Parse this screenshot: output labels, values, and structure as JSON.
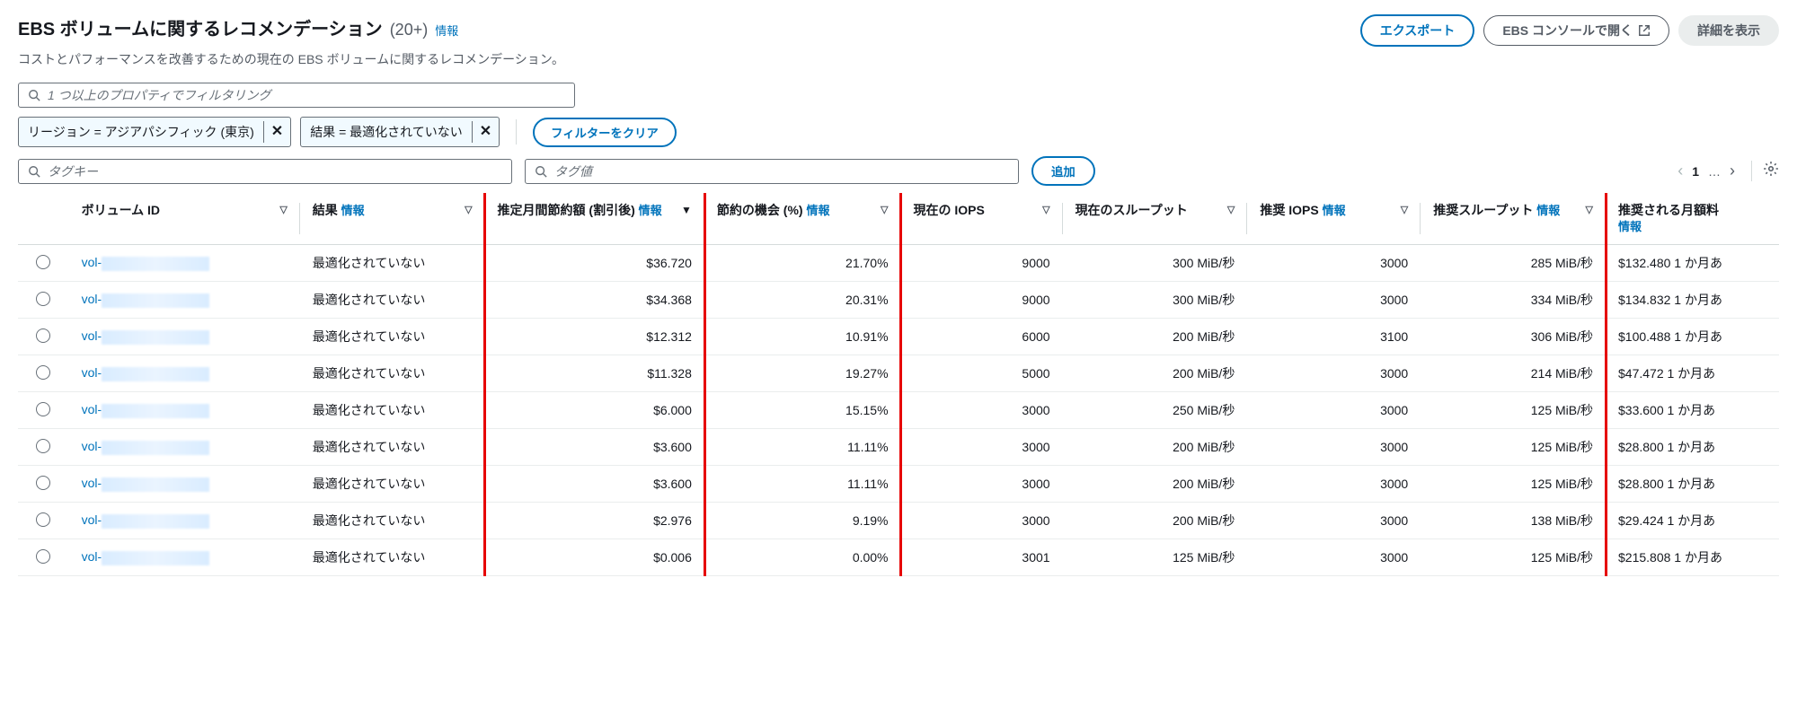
{
  "header": {
    "title": "EBS ボリュームに関するレコメンデーション",
    "count": "(20+)",
    "info": "情報",
    "subtitle": "コストとパフォーマンスを改善するための現在の EBS ボリュームに関するレコメンデーション。",
    "export_btn": "エクスポート",
    "console_btn": "EBS コンソールで開く",
    "detail_btn": "詳細を表示"
  },
  "filters": {
    "main_placeholder": "1 つ以上のプロパティでフィルタリング",
    "token_region": "リージョン = アジアパシフィック (東京)",
    "token_result": "結果 = 最適化されていない",
    "clear": "フィルターをクリア",
    "tagkey_placeholder": "タグキー",
    "tagval_placeholder": "タグ値",
    "add": "追加"
  },
  "pager": {
    "page": "1",
    "ellipsis": "…"
  },
  "columns": {
    "volume_id": "ボリューム ID",
    "result": "結果",
    "savings": "推定月間節約額 (割引後)",
    "opportunity": "節約の機会 (%)",
    "cur_iops": "現在の IOPS",
    "cur_tp": "現在のスループット",
    "rec_iops": "推奨 IOPS",
    "rec_tp": "推奨スループット",
    "rec_monthly": "推奨される月額料",
    "info": "情報"
  },
  "rows": [
    {
      "vol": "vol-",
      "res": "最適化されていない",
      "sav": "$36.720",
      "opp": "21.70%",
      "ci": "9000",
      "ct": "300 MiB/秒",
      "ri": "3000",
      "rt": "285 MiB/秒",
      "rm": "$132.480 1 か月あ"
    },
    {
      "vol": "vol-",
      "res": "最適化されていない",
      "sav": "$34.368",
      "opp": "20.31%",
      "ci": "9000",
      "ct": "300 MiB/秒",
      "ri": "3000",
      "rt": "334 MiB/秒",
      "rm": "$134.832 1 か月あ"
    },
    {
      "vol": "vol-",
      "res": "最適化されていない",
      "sav": "$12.312",
      "opp": "10.91%",
      "ci": "6000",
      "ct": "200 MiB/秒",
      "ri": "3100",
      "rt": "306 MiB/秒",
      "rm": "$100.488 1 か月あ"
    },
    {
      "vol": "vol-",
      "res": "最適化されていない",
      "sav": "$11.328",
      "opp": "19.27%",
      "ci": "5000",
      "ct": "200 MiB/秒",
      "ri": "3000",
      "rt": "214 MiB/秒",
      "rm": "$47.472 1 か月あ"
    },
    {
      "vol": "vol-",
      "res": "最適化されていない",
      "sav": "$6.000",
      "opp": "15.15%",
      "ci": "3000",
      "ct": "250 MiB/秒",
      "ri": "3000",
      "rt": "125 MiB/秒",
      "rm": "$33.600 1 か月あ"
    },
    {
      "vol": "vol-",
      "res": "最適化されていない",
      "sav": "$3.600",
      "opp": "11.11%",
      "ci": "3000",
      "ct": "200 MiB/秒",
      "ri": "3000",
      "rt": "125 MiB/秒",
      "rm": "$28.800 1 か月あ"
    },
    {
      "vol": "vol-",
      "res": "最適化されていない",
      "sav": "$3.600",
      "opp": "11.11%",
      "ci": "3000",
      "ct": "200 MiB/秒",
      "ri": "3000",
      "rt": "125 MiB/秒",
      "rm": "$28.800 1 か月あ"
    },
    {
      "vol": "vol-",
      "res": "最適化されていない",
      "sav": "$2.976",
      "opp": "9.19%",
      "ci": "3000",
      "ct": "200 MiB/秒",
      "ri": "3000",
      "rt": "138 MiB/秒",
      "rm": "$29.424 1 か月あ"
    },
    {
      "vol": "vol-",
      "res": "最適化されていない",
      "sav": "$0.006",
      "opp": "0.00%",
      "ci": "3001",
      "ct": "125 MiB/秒",
      "ri": "3000",
      "rt": "125 MiB/秒",
      "rm": "$215.808 1 か月あ"
    }
  ]
}
